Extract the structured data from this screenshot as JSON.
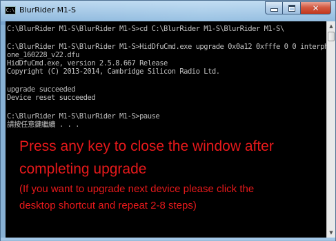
{
  "window": {
    "title": "BlurRider M1-S",
    "icon_label": "C:\\",
    "icon": "console-icon",
    "controls": {
      "minimize_icon": "minimize-icon",
      "maximize_icon": "maximize-icon",
      "close_icon": "close-icon",
      "close_glyph": "✕"
    }
  },
  "console": {
    "lines": [
      "C:\\BlurRider M1-S\\BlurRider M1-S>cd C:\\BlurRider M1-S\\BlurRider M1-S\\",
      "",
      "C:\\BlurRider M1-S\\BlurRider M1-S>HidDfuCmd.exe upgrade 0x0a12 0xfffe 0 0 interph",
      "one_160228_v22.dfu",
      "HidDfuCmd.exe, version 2.5.8.667 Release",
      "Copyright (C) 2013-2014, Cambridge Silicon Radio Ltd.",
      "",
      "upgrade succeeded",
      "Device reset succeeded",
      "",
      "C:\\BlurRider M1-S\\BlurRider M1-S>pause",
      "請按任意鍵繼續 . . ."
    ],
    "text_color": "#c0c0c0",
    "background": "#000000"
  },
  "instructions": {
    "line1": "Press any key to close the window after",
    "line2": "completing upgrade",
    "line3": "(If you want to upgrade next device please click the",
    "line4": "desktop shortcut and repeat 2-8 steps)",
    "color": "#e8191b"
  },
  "scrollbar": {
    "up_arrow": "▲",
    "down_arrow": "▼"
  }
}
